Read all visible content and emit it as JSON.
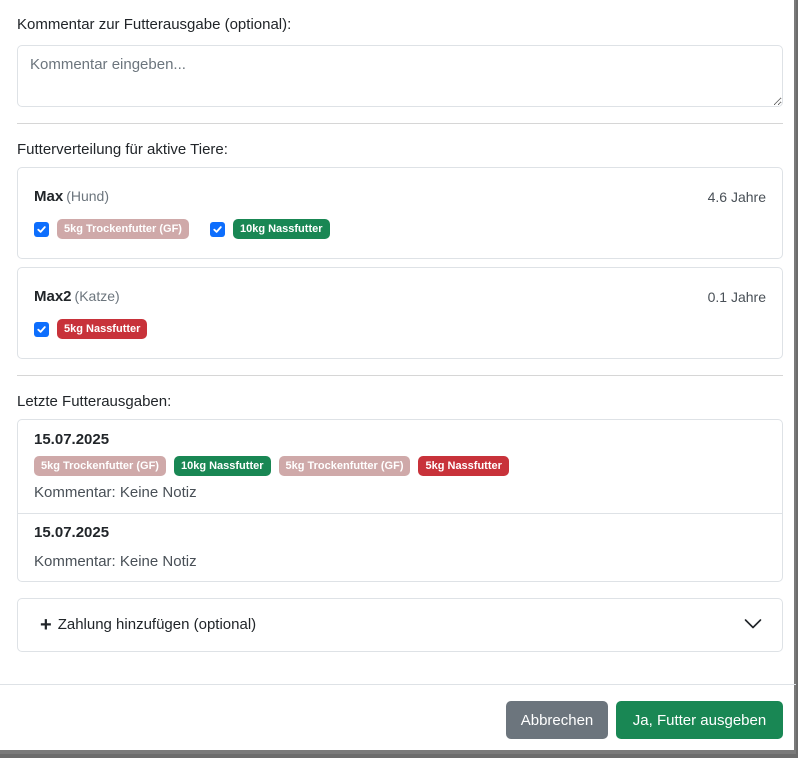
{
  "comment": {
    "label": "Kommentar zur Futterausgabe (optional):",
    "placeholder": "Kommentar eingeben...",
    "value": ""
  },
  "distribution": {
    "label": "Futterverteilung für aktive Tiere:",
    "pets": [
      {
        "name": "Max",
        "species": "(Hund)",
        "age": "4.6 Jahre",
        "feeds": [
          {
            "label": "5kg Trockenfutter (GF)",
            "checked": true,
            "color": "#cfa9a9"
          },
          {
            "label": "10kg Nassfutter",
            "checked": true,
            "color": "#198754"
          }
        ]
      },
      {
        "name": "Max2",
        "species": "(Katze)",
        "age": "0.1 Jahre",
        "feeds": [
          {
            "label": "5kg Nassfutter",
            "checked": true,
            "color": "#c8323a"
          }
        ]
      }
    ]
  },
  "history": {
    "label": "Letzte Futterausgaben:",
    "entries": [
      {
        "date": "15.07.2025",
        "badges": [
          "5kg Trockenfutter (GF)",
          "10kg Nassfutter",
          "5kg Trockenfutter (GF)",
          "5kg Nassfutter"
        ],
        "comment": "Kommentar: Keine Notiz"
      },
      {
        "date": "15.07.2025",
        "badges": [],
        "comment": "Kommentar: Keine Notiz"
      }
    ]
  },
  "payment": {
    "label": "Zahlung hinzufügen (optional)"
  },
  "footer": {
    "cancel_label": "Abbrechen",
    "confirm_label": "Ja, Futter ausgeben"
  },
  "colors": {
    "primary": "#0d6efd",
    "success": "#198754",
    "danger": "#c8323a",
    "secondary": "#6c757d",
    "dry_food": "#cfa9a9"
  }
}
